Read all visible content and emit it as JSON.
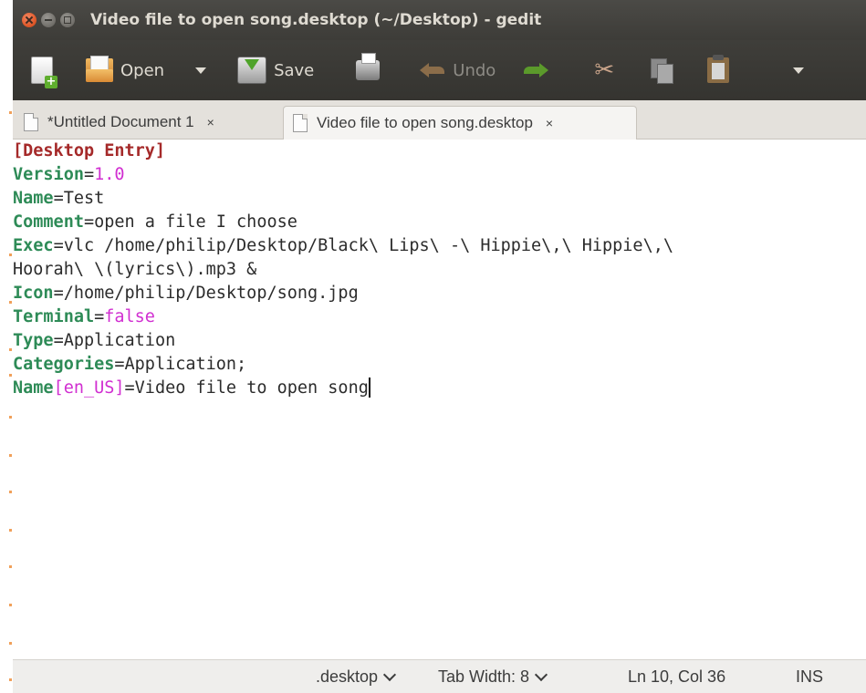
{
  "window": {
    "title": "Video file to open song.desktop (~/Desktop) - gedit"
  },
  "toolbar": {
    "open_label": "Open",
    "save_label": "Save",
    "undo_label": "Undo"
  },
  "tabs": [
    {
      "label": "*Untitled Document 1",
      "close": "×",
      "active": false
    },
    {
      "label": "Video file to open song.desktop",
      "close": "×",
      "active": true
    }
  ],
  "editor": {
    "lines": [
      {
        "section": "[Desktop Entry]"
      },
      {
        "key": "Version",
        "eq": "=",
        "value": "1.0",
        "value_type": "number"
      },
      {
        "key": "Name",
        "eq": "=",
        "value": "Test"
      },
      {
        "key": "Comment",
        "eq": "=",
        "value": "open a file I choose"
      },
      {
        "key": "Exec",
        "eq": "=",
        "value": "vlc /home/philip/Desktop/Black\\ Lips\\ -\\ Hippie\\,\\ Hippie\\,\\"
      },
      {
        "continuation": "Hoorah\\ \\(lyrics\\).mp3 &"
      },
      {
        "key": "Icon",
        "eq": "=",
        "value": "/home/philip/Desktop/song.jpg"
      },
      {
        "key": "Terminal",
        "eq": "=",
        "value": "false",
        "value_type": "bool"
      },
      {
        "key": "Type",
        "eq": "=",
        "value": "Application"
      },
      {
        "key": "Categories",
        "eq": "=",
        "value": "Application;"
      },
      {
        "key": "Name",
        "locale": "[en_US]",
        "eq": "=",
        "value": "Video file to open song"
      }
    ]
  },
  "statusbar": {
    "language": ".desktop",
    "tab_width": "Tab Width: 8",
    "position": "Ln 10, Col 36",
    "mode": "INS"
  },
  "colors": {
    "key": "#2e8b57",
    "section": "#a52a2a",
    "literal": "#d12fd1",
    "titlebar": "#3d3c38",
    "close_button": "#e05a2b"
  }
}
